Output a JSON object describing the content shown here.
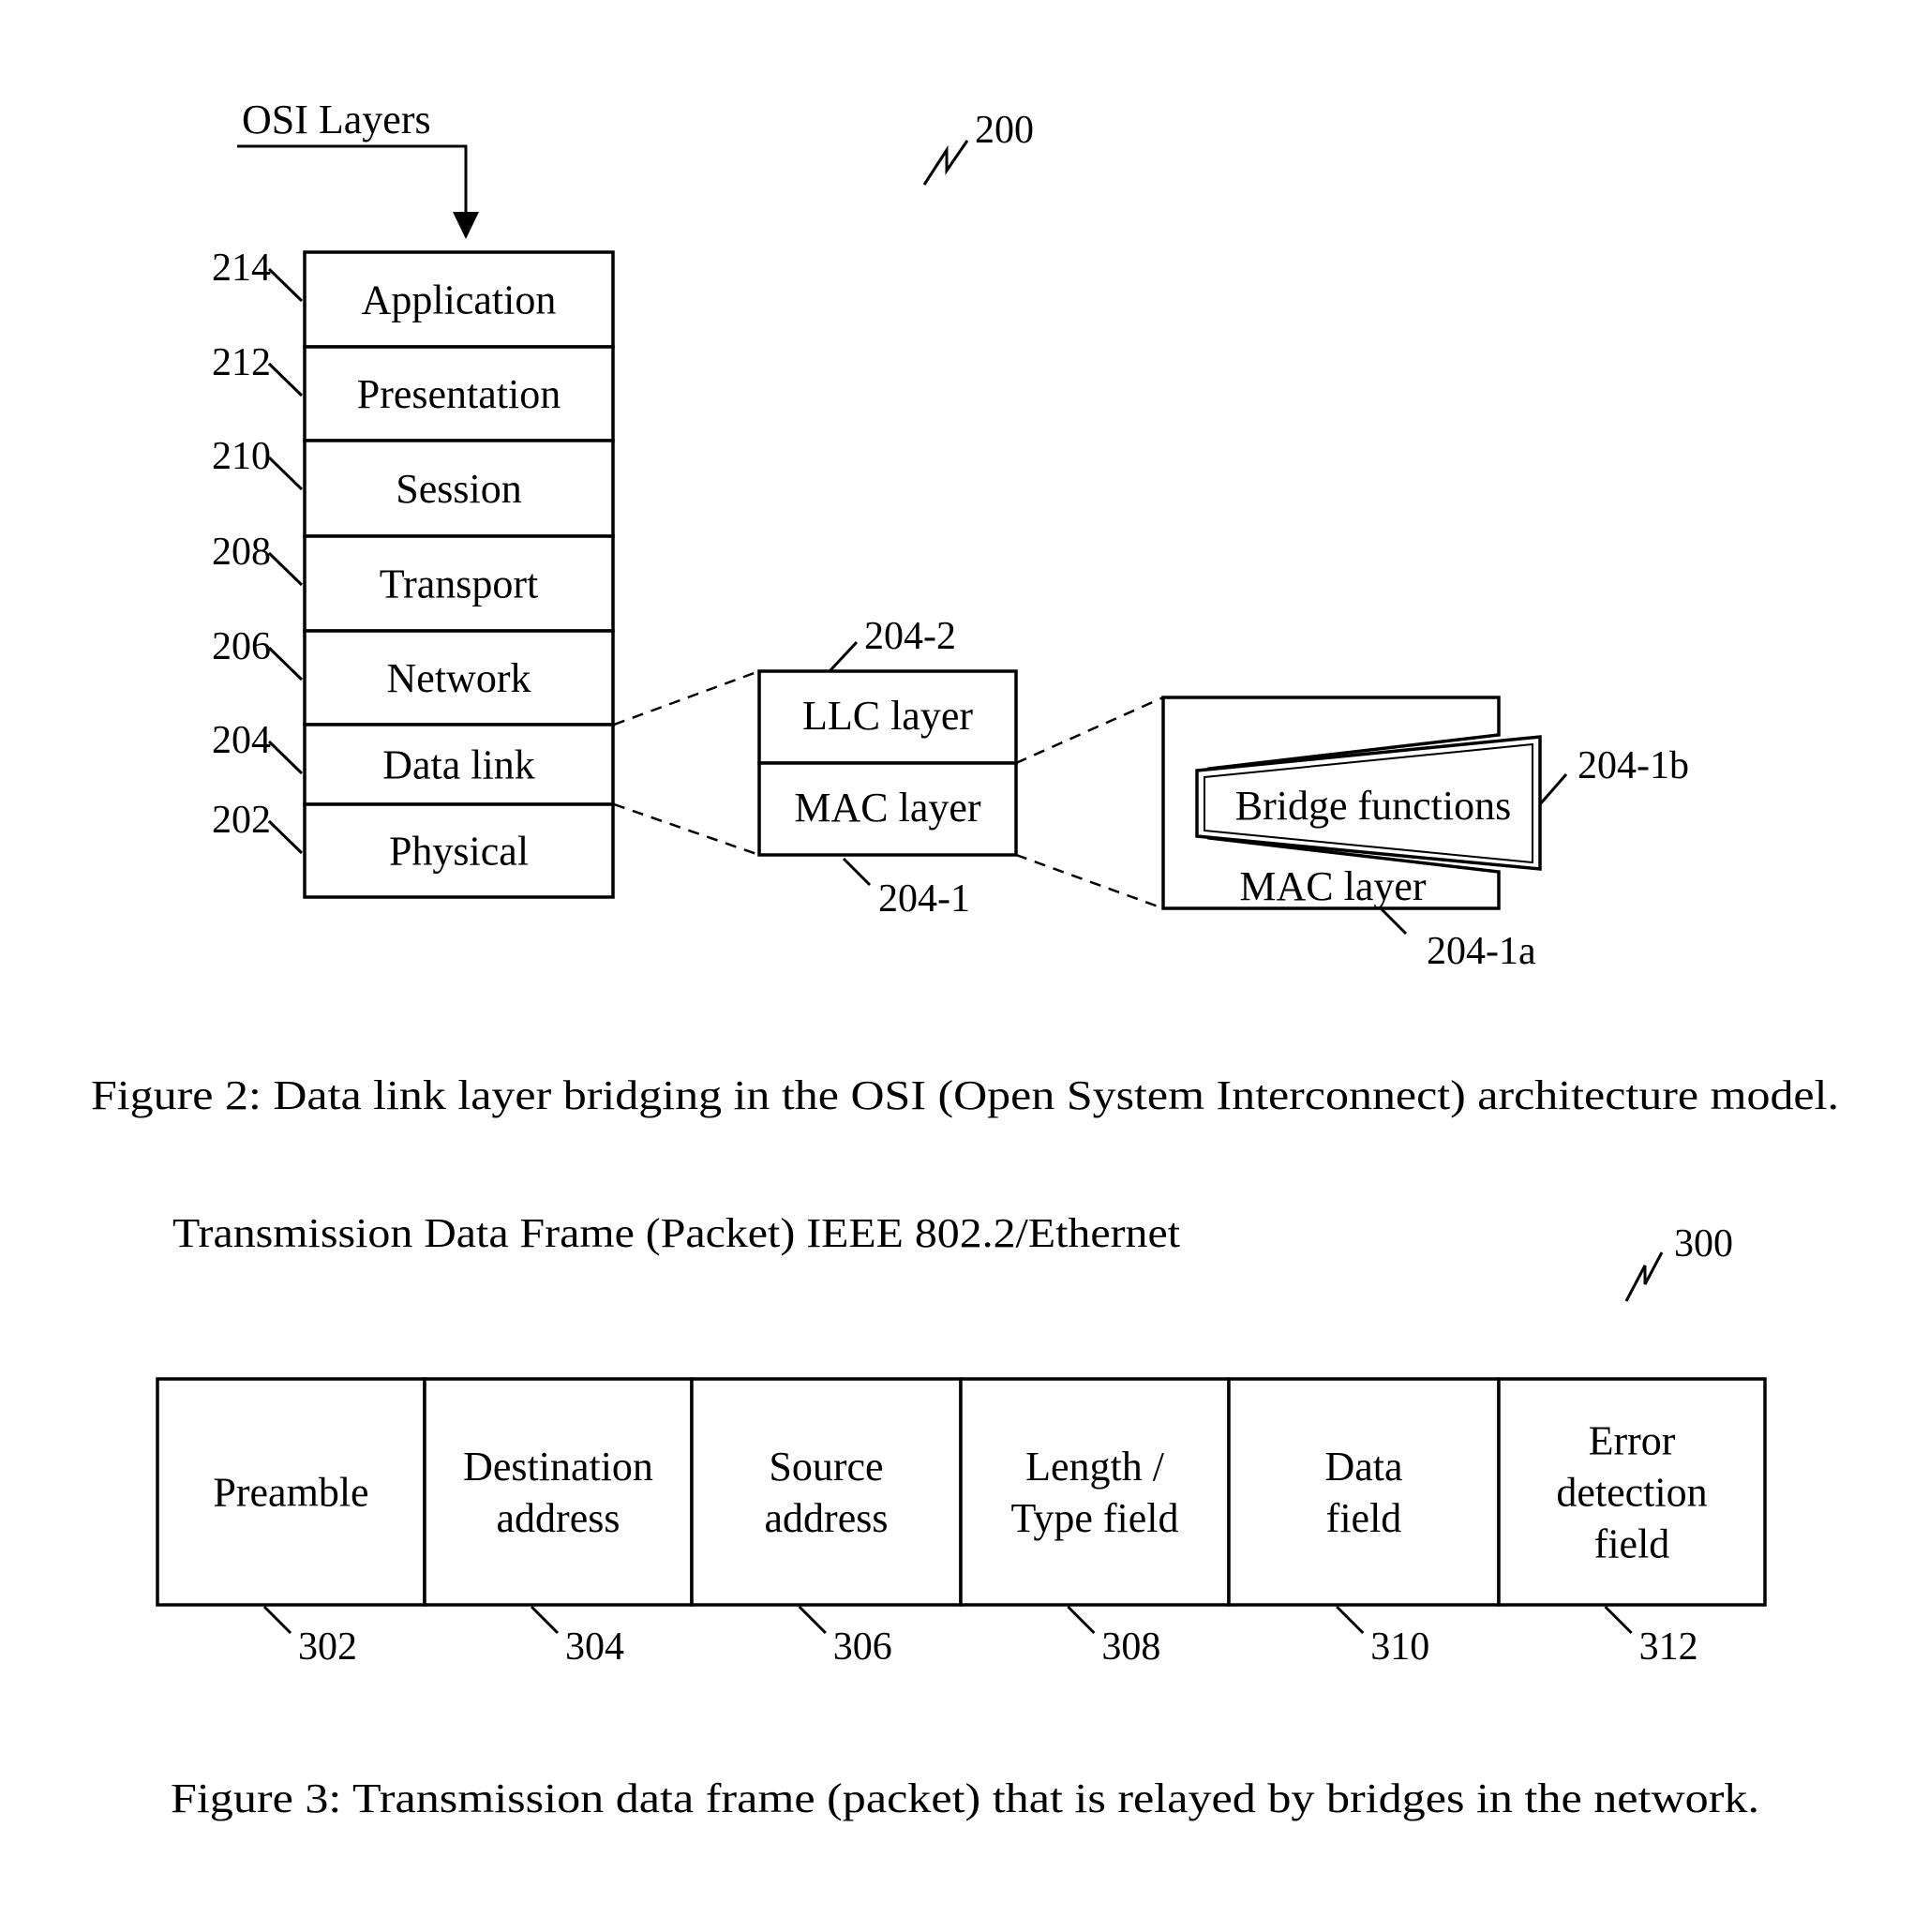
{
  "figure2": {
    "ref_number": "200",
    "osi_label": "OSI Layers",
    "layers": [
      {
        "name": "Application",
        "ref": "214"
      },
      {
        "name": "Presentation",
        "ref": "212"
      },
      {
        "name": "Session",
        "ref": "210"
      },
      {
        "name": "Transport",
        "ref": "208"
      },
      {
        "name": "Network",
        "ref": "206"
      },
      {
        "name": "Data link",
        "ref": "204"
      },
      {
        "name": "Physical",
        "ref": "202"
      }
    ],
    "sublayers": {
      "llc": {
        "name": "LLC layer",
        "ref": "204-2"
      },
      "mac": {
        "name": "MAC layer",
        "ref": "204-1"
      }
    },
    "mac_detail": {
      "bridge": {
        "name": "Bridge functions",
        "ref": "204-1b"
      },
      "mac": {
        "name": "MAC layer",
        "ref": "204-1a"
      }
    },
    "caption": "Figure 2: Data link layer bridging in the OSI (Open System Interconnect) architecture model."
  },
  "figure3": {
    "ref_number": "300",
    "title": "Transmission Data Frame (Packet) IEEE 802.2/Ethernet",
    "fields": [
      {
        "lines": [
          "Preamble"
        ],
        "ref": "302"
      },
      {
        "lines": [
          "Destination",
          "address"
        ],
        "ref": "304"
      },
      {
        "lines": [
          "Source",
          "address"
        ],
        "ref": "306"
      },
      {
        "lines": [
          "Length /",
          "Type field"
        ],
        "ref": "308"
      },
      {
        "lines": [
          "Data",
          "field"
        ],
        "ref": "310"
      },
      {
        "lines": [
          "Error",
          "detection",
          "field"
        ],
        "ref": "312"
      }
    ],
    "caption": "Figure 3: Transmission data frame (packet) that is relayed by bridges in the network."
  }
}
